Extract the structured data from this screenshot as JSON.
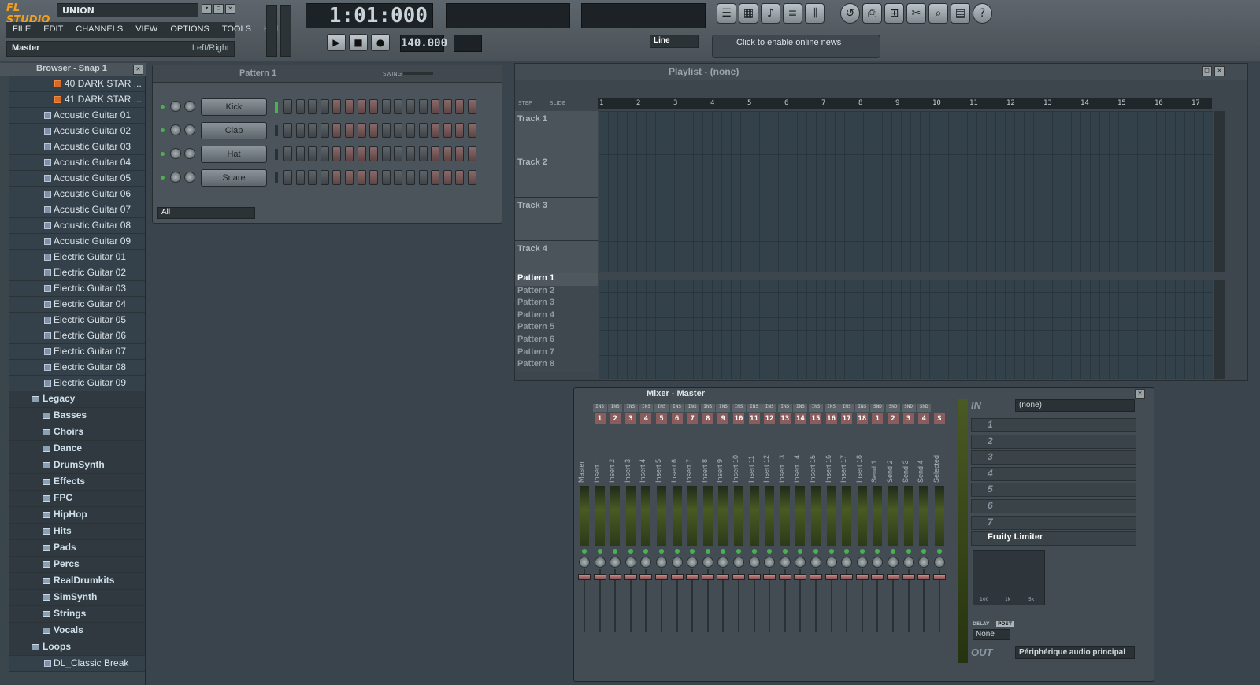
{
  "app": {
    "logo": "FL STUDIO",
    "song_name": "UNION",
    "menus": [
      "FILE",
      "EDIT",
      "CHANNELS",
      "VIEW",
      "OPTIONS",
      "TOOLS",
      "HELP"
    ],
    "hint_left": "Master",
    "hint_right": "Left/Right",
    "time_display": "1:01:000",
    "tempo": "140.000",
    "snap_mode": "Line",
    "news": "Click to enable online news"
  },
  "browser": {
    "title": "Browser - Snap 1",
    "items": [
      {
        "kind": "star",
        "label": "40 DARK STAR ..."
      },
      {
        "kind": "star",
        "label": "41 DARK STAR ..."
      },
      {
        "kind": "file",
        "label": "Acoustic Guitar 01"
      },
      {
        "kind": "file",
        "label": "Acoustic Guitar 02"
      },
      {
        "kind": "file",
        "label": "Acoustic Guitar 03"
      },
      {
        "kind": "file",
        "label": "Acoustic Guitar 04"
      },
      {
        "kind": "file",
        "label": "Acoustic Guitar 05"
      },
      {
        "kind": "file",
        "label": "Acoustic Guitar 06"
      },
      {
        "kind": "file",
        "label": "Acoustic Guitar 07"
      },
      {
        "kind": "file",
        "label": "Acoustic Guitar 08"
      },
      {
        "kind": "file",
        "label": "Acoustic Guitar 09"
      },
      {
        "kind": "file",
        "label": "Electric Guitar 01"
      },
      {
        "kind": "file",
        "label": "Electric Guitar 02"
      },
      {
        "kind": "file",
        "label": "Electric Guitar 03"
      },
      {
        "kind": "file",
        "label": "Electric Guitar 04"
      },
      {
        "kind": "file",
        "label": "Electric Guitar 05"
      },
      {
        "kind": "file",
        "label": "Electric Guitar 06"
      },
      {
        "kind": "file",
        "label": "Electric Guitar 07"
      },
      {
        "kind": "file",
        "label": "Electric Guitar 08"
      },
      {
        "kind": "file",
        "label": "Electric Guitar 09"
      },
      {
        "kind": "folder",
        "label": "Legacy"
      },
      {
        "kind": "sub",
        "label": "Basses"
      },
      {
        "kind": "sub",
        "label": "Choirs"
      },
      {
        "kind": "sub",
        "label": "Dance"
      },
      {
        "kind": "sub",
        "label": "DrumSynth"
      },
      {
        "kind": "sub",
        "label": "Effects"
      },
      {
        "kind": "sub",
        "label": "FPC"
      },
      {
        "kind": "sub",
        "label": "HipHop"
      },
      {
        "kind": "sub",
        "label": "Hits"
      },
      {
        "kind": "sub",
        "label": "Pads"
      },
      {
        "kind": "sub",
        "label": "Percs"
      },
      {
        "kind": "sub",
        "label": "RealDrumkits"
      },
      {
        "kind": "sub",
        "label": "SimSynth"
      },
      {
        "kind": "sub",
        "label": "Strings"
      },
      {
        "kind": "sub",
        "label": "Vocals"
      },
      {
        "kind": "folder",
        "label": "Loops"
      },
      {
        "kind": "file",
        "label": "DL_Classic Break"
      }
    ]
  },
  "channel_rack": {
    "pattern": "Pattern 1",
    "swing_label": "SWING",
    "filter": "All",
    "channels": [
      "Kick",
      "Clap",
      "Hat",
      "Snare"
    ]
  },
  "playlist": {
    "title": "Playlist - (none)",
    "step_label": "STEP",
    "slide_label": "SLIDE",
    "bars": [
      "1",
      "2",
      "3",
      "4",
      "5",
      "6",
      "7",
      "8",
      "9",
      "10",
      "11",
      "12",
      "13",
      "14",
      "15",
      "16",
      "17"
    ],
    "tracks": [
      "Track 1",
      "Track 2",
      "Track 3",
      "Track 4"
    ],
    "patterns": [
      "Pattern 1",
      "Pattern 2",
      "Pattern 3",
      "Pattern 4",
      "Pattern 5",
      "Pattern 6",
      "Pattern 7",
      "Pattern 8"
    ],
    "selected_pattern": "Pattern 1"
  },
  "mixer": {
    "title": "Mixer - Master",
    "strips": [
      {
        "tag": "",
        "num": "",
        "name": "Master"
      },
      {
        "tag": "INS",
        "num": "1",
        "name": "Insert 1"
      },
      {
        "tag": "INS",
        "num": "2",
        "name": "Insert 2"
      },
      {
        "tag": "INS",
        "num": "3",
        "name": "Insert 3"
      },
      {
        "tag": "INS",
        "num": "4",
        "name": "Insert 4"
      },
      {
        "tag": "INS",
        "num": "5",
        "name": "Insert 5"
      },
      {
        "tag": "INS",
        "num": "6",
        "name": "Insert 6"
      },
      {
        "tag": "INS",
        "num": "7",
        "name": "Insert 7"
      },
      {
        "tag": "INS",
        "num": "8",
        "name": "Insert 8"
      },
      {
        "tag": "INS",
        "num": "9",
        "name": "Insert 9"
      },
      {
        "tag": "INS",
        "num": "10",
        "name": "Insert 10"
      },
      {
        "tag": "INS",
        "num": "11",
        "name": "Insert 11"
      },
      {
        "tag": "INS",
        "num": "12",
        "name": "Insert 12"
      },
      {
        "tag": "INS",
        "num": "13",
        "name": "Insert 13"
      },
      {
        "tag": "INS",
        "num": "14",
        "name": "Insert 14"
      },
      {
        "tag": "INS",
        "num": "15",
        "name": "Insert 15"
      },
      {
        "tag": "INS",
        "num": "16",
        "name": "Insert 16"
      },
      {
        "tag": "INS",
        "num": "17",
        "name": "Insert 17"
      },
      {
        "tag": "INS",
        "num": "18",
        "name": "Insert 18"
      },
      {
        "tag": "SND",
        "num": "1",
        "name": "Send 1"
      },
      {
        "tag": "SND",
        "num": "2",
        "name": "Send 2"
      },
      {
        "tag": "SND",
        "num": "3",
        "name": "Send 3"
      },
      {
        "tag": "SND",
        "num": "4",
        "name": "Send 4"
      },
      {
        "tag": "",
        "num": "S",
        "name": "Selected"
      }
    ],
    "in_label": "IN",
    "in_value": "(none)",
    "fx_slots": [
      "1",
      "2",
      "3",
      "4",
      "5",
      "6",
      "7"
    ],
    "limiter": "Fruity Limiter",
    "eq_labels": [
      "100",
      "1k",
      "5k"
    ],
    "delay_label": "DELAY",
    "post_label": "POST",
    "delay_value": "None",
    "out_label": "OUT",
    "out_value": "Périphérique audio principal"
  },
  "colors": {
    "accent": "#f0a020",
    "step_red": "#8a5c5c",
    "led_green": "#4caf50"
  }
}
